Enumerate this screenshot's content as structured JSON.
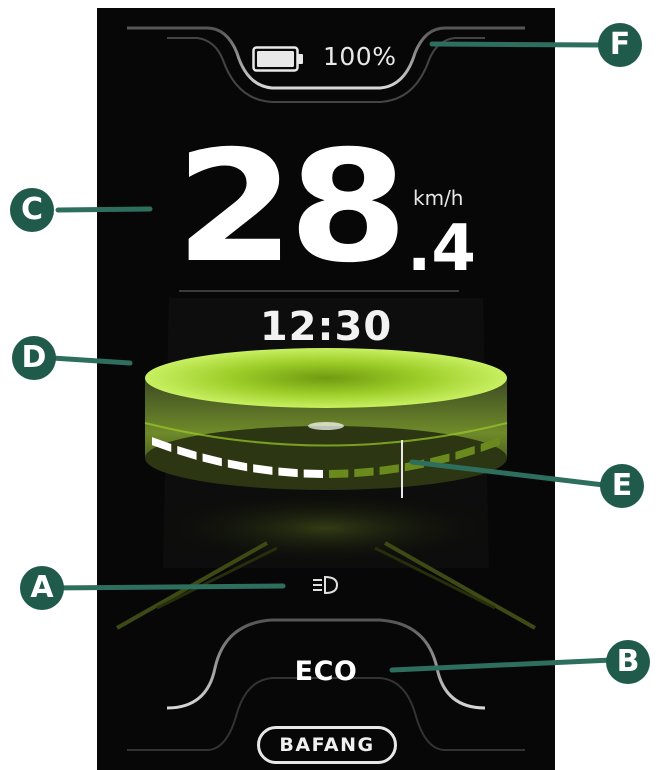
{
  "status_bar": {
    "battery_level": "100%",
    "battery_fill_fraction": 1.0,
    "icon": "battery-icon"
  },
  "speed": {
    "integer": "28",
    "decimal": ".4",
    "unit": "km/h"
  },
  "clock": "12:30",
  "assist": {
    "filled_segments": 7,
    "total_segments": 14
  },
  "headlight": {
    "icon": "headlight-icon"
  },
  "mode": "ECO",
  "brand": "BAFANG",
  "callouts": [
    "A",
    "B",
    "C",
    "D",
    "E",
    "F"
  ],
  "colors": {
    "accent_green": "#a6d62a",
    "callout": "#1f5a4a",
    "background": "#070707"
  }
}
